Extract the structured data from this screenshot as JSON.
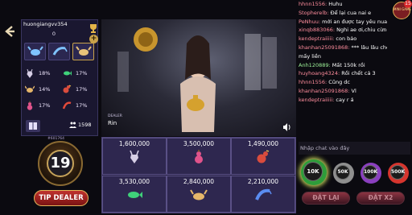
{
  "user": {
    "name": "huongiangvv354",
    "balance": "0"
  },
  "history": [
    "crab",
    "shrimp",
    "crab"
  ],
  "stats": [
    {
      "icon": "deer-icon",
      "value": "18%"
    },
    {
      "icon": "fish-icon",
      "value": "17%"
    },
    {
      "icon": "crab-icon",
      "value": "14%"
    },
    {
      "icon": "rooster-icon",
      "value": "17%"
    },
    {
      "icon": "gourd-icon",
      "value": "17%"
    },
    {
      "icon": "shrimp-icon",
      "value": "17%"
    }
  ],
  "players": "1598",
  "game_id": "#601764",
  "timer": "19",
  "tip_label": "TIP DEALER",
  "dealer": {
    "label": "DEALER",
    "name": "Rin"
  },
  "bets": [
    {
      "amount": "1,600,000",
      "icon": "deer-icon"
    },
    {
      "amount": "3,500,000",
      "icon": "gourd-icon"
    },
    {
      "amount": "1,490,000",
      "icon": "rooster-icon"
    },
    {
      "amount": "3,530,000",
      "icon": "fish-icon"
    },
    {
      "amount": "2,840,000",
      "icon": "crab-icon"
    },
    {
      "amount": "2,210,000",
      "icon": "shrimp-icon"
    }
  ],
  "chat": [
    {
      "user": "hhnn1556:",
      "text": " Huhu"
    },
    {
      "user": "Stopherelb:",
      "text": " Để lại cua nai e"
    },
    {
      "user": "PeNhuu:",
      "text": " mới an được tay yêu nua"
    },
    {
      "user": "xinqb883066:",
      "text": " Nghi ae ơi,chiu cừng"
    },
    {
      "user": "kendeptraiiiii:",
      "text": " con bảo"
    },
    {
      "user": "khanhan25091868:",
      "text": " *** lâu lâu chọt nai"
    },
    {
      "user": "",
      "text": "mấy liền"
    },
    {
      "user": "Anh120889:",
      "text": " Mất 150k rồi"
    },
    {
      "user": "huyhoang4324:",
      "text": " Rồi chết cả 3"
    },
    {
      "user": "hhnn1556:",
      "text": " Cũng dc"
    },
    {
      "user": "khanhan25091868:",
      "text": " Vl"
    },
    {
      "user": "kendeptraiiiii:",
      "text": " cay r á"
    }
  ],
  "mini_game": {
    "badge": "15",
    "label": "MINI GAME"
  },
  "chat_placeholder": "Nhập chat vào đây",
  "chips": [
    "10K",
    "50K",
    "100K",
    "500K"
  ],
  "buttons": {
    "rebet": "ĐẶT LẠI",
    "double": "ĐẶT X2"
  },
  "colors": {
    "panel": "#1a1730",
    "accent_gold": "#c9a24a",
    "username_pink": "#ff8d9d"
  }
}
